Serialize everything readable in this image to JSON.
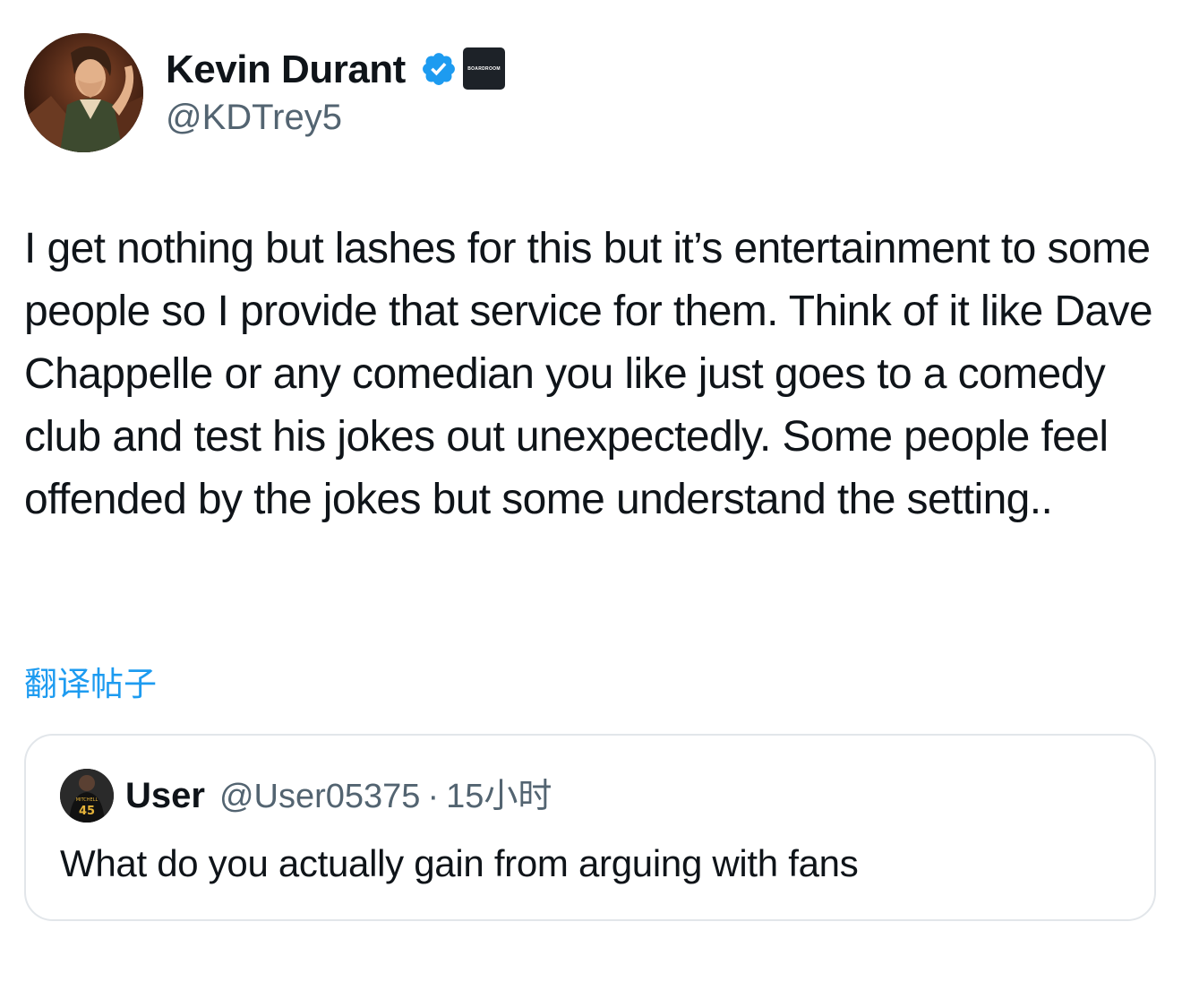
{
  "author": {
    "name": "Kevin Durant",
    "handle": "@KDTrey5",
    "verified_icon": "verified-badge-icon",
    "affiliate_badge": "BOARDROOM"
  },
  "tweet": {
    "text": "I get nothing but lashes for this but it’s entertainment to some people so I provide that service for them. Think of it like Dave Chappelle or any comedian you like just goes to a comedy club and test his jokes out unexpectedly. Some people feel offended by the jokes but some understand the setting..",
    "translate_label": "翻译帖子"
  },
  "quoted_tweet": {
    "name": "User",
    "handle": "@User05375",
    "separator": "·",
    "time": "15小时",
    "text": "What do you actually gain from arguing with fans"
  },
  "colors": {
    "link": "#1d9bf0",
    "secondary_text": "#536471",
    "primary_text": "#0f1419",
    "border": "#e2e6ea",
    "verified": "#1d9bf0"
  }
}
